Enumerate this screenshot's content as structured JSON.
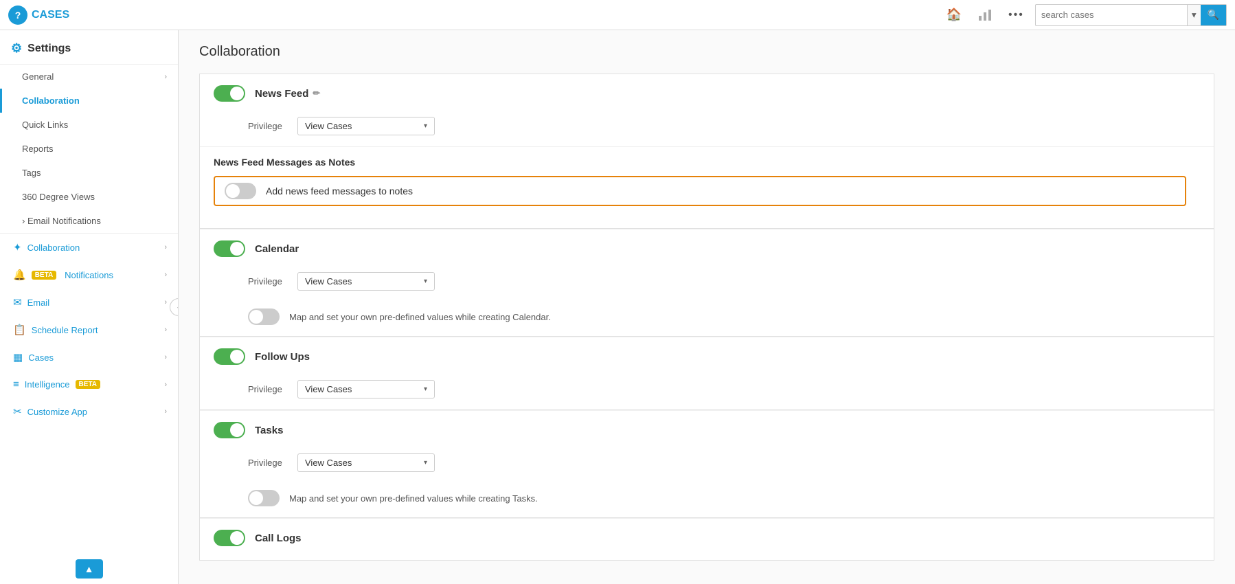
{
  "header": {
    "brand": "CASES",
    "search_placeholder": "search cases",
    "home_icon": "🏠",
    "chart_icon": "📊",
    "more_icon": "•••"
  },
  "sidebar": {
    "title": "Settings",
    "sections": [
      {
        "items": [
          {
            "label": "General",
            "type": "sub-arrow",
            "active": false
          },
          {
            "label": "Collaboration",
            "type": "sub",
            "active": true
          },
          {
            "label": "Quick Links",
            "type": "sub",
            "active": false
          },
          {
            "label": "Reports",
            "type": "sub",
            "active": false
          },
          {
            "label": "Tags",
            "type": "sub",
            "active": false
          },
          {
            "label": "360 Degree Views",
            "type": "sub",
            "active": false
          },
          {
            "label": "Email Notifications",
            "type": "sub-arrow",
            "active": false
          }
        ]
      },
      {
        "nav_items": [
          {
            "label": "Collaboration",
            "icon": "✦",
            "active": false,
            "has_arrow": true,
            "beta": false
          },
          {
            "label": "Notifications",
            "icon": "🔔",
            "active": false,
            "has_arrow": true,
            "beta": true
          },
          {
            "label": "Email",
            "icon": "✉",
            "active": false,
            "has_arrow": true,
            "beta": false
          },
          {
            "label": "Schedule Report",
            "icon": "📋",
            "active": false,
            "has_arrow": true,
            "beta": false
          },
          {
            "label": "Cases",
            "icon": "▦",
            "active": false,
            "has_arrow": true,
            "beta": false
          },
          {
            "label": "Intelligence",
            "icon": "≡",
            "active": false,
            "has_arrow": true,
            "beta": true
          },
          {
            "label": "Customize App",
            "icon": "✂",
            "active": false,
            "has_arrow": true,
            "beta": false
          }
        ]
      }
    ],
    "scroll_up_btn": "▲"
  },
  "main": {
    "page_title": "Collaboration",
    "sections": [
      {
        "id": "news_feed",
        "title": "News Feed",
        "enabled": true,
        "has_edit": true,
        "privilege_label": "Privilege",
        "privilege_value": "View Cases",
        "sub_section": {
          "title": "News Feed Messages as Notes",
          "toggle_off": true,
          "toggle_label": "Add news feed messages to notes",
          "highlighted": true
        }
      },
      {
        "id": "calendar",
        "title": "Calendar",
        "enabled": true,
        "privilege_label": "Privilege",
        "privilege_value": "View Cases",
        "extra_toggle": true,
        "extra_toggle_label": "Map and set your own pre-defined values while creating Calendar."
      },
      {
        "id": "follow_ups",
        "title": "Follow Ups",
        "enabled": true,
        "privilege_label": "Privilege",
        "privilege_value": "View Cases"
      },
      {
        "id": "tasks",
        "title": "Tasks",
        "enabled": true,
        "privilege_label": "Privilege",
        "privilege_value": "View Cases",
        "extra_toggle": true,
        "extra_toggle_label": "Map and set your own pre-defined values while creating Tasks."
      },
      {
        "id": "call_logs",
        "title": "Call Logs",
        "enabled": true,
        "partial": true
      }
    ]
  }
}
